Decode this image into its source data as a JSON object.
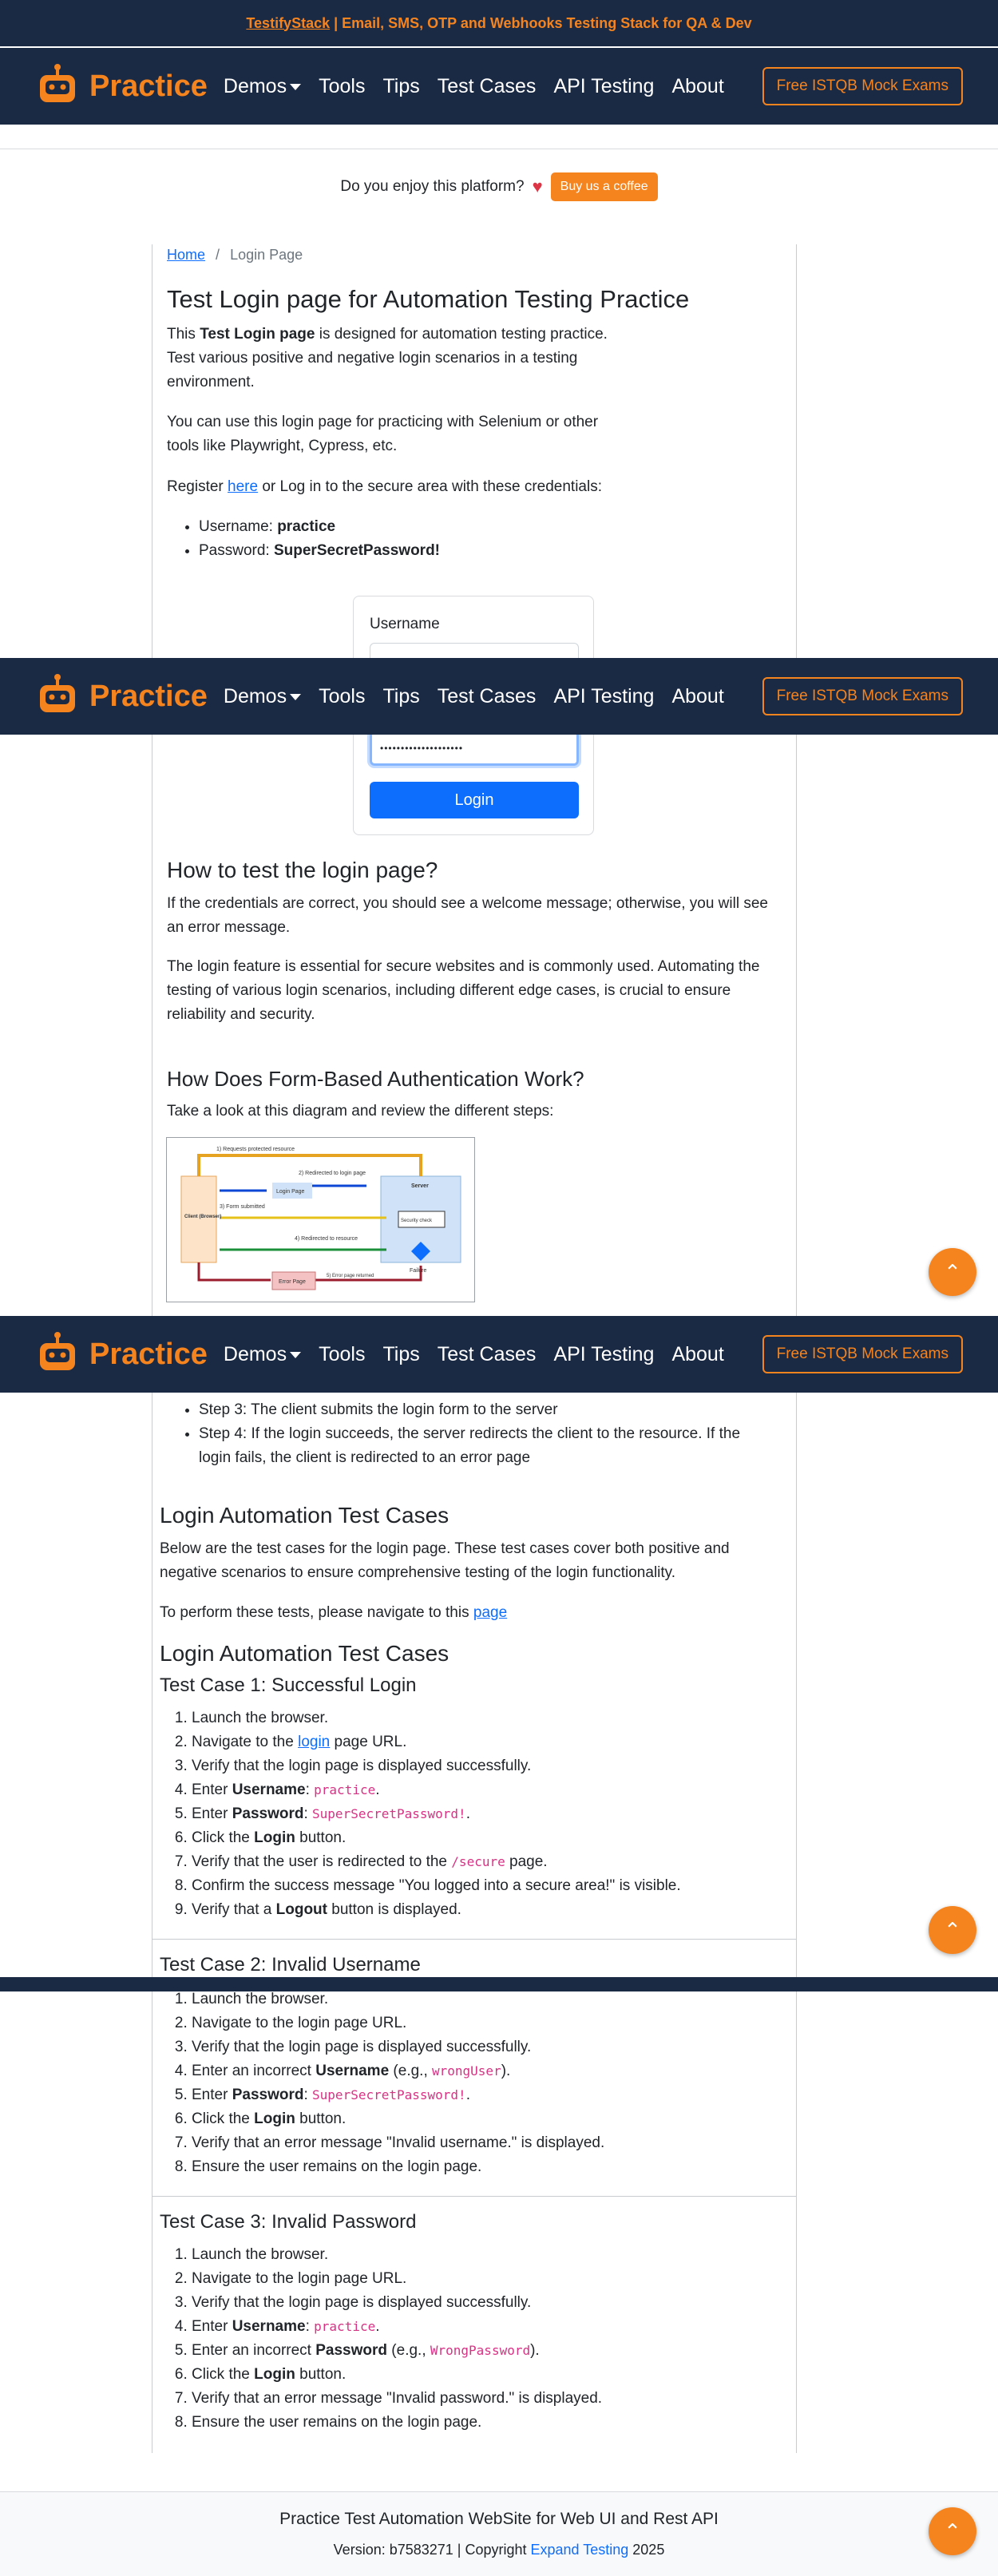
{
  "topbar": {
    "brand": "TestifyStack",
    "tagline": " | Email, SMS, OTP and Webhooks Testing Stack for QA & Dev"
  },
  "nav": {
    "logo_text": "Practice",
    "items": [
      "Demos",
      "Tools",
      "Tips",
      "Test Cases",
      "API Testing",
      "About"
    ],
    "exam_button": "Free ISTQB Mock Exams"
  },
  "coffee": {
    "text": "Do you enjoy this platform?",
    "button": "Buy us a coffee"
  },
  "breadcrumb": {
    "home": "Home",
    "sep": "/",
    "current": "Login Page"
  },
  "intro": {
    "title": "Test Login page for Automation Testing Practice",
    "p1_a": "This ",
    "p1_b": "Test Login page",
    "p1_c": " is designed for automation testing practice. Test various positive and negative login scenarios in a testing environment.",
    "p2": "You can use this login page for practicing with Selenium or other tools like Playwright, Cypress, etc.",
    "p3_a": "Register ",
    "p3_link": "here",
    "p3_b": " or Log in to the secure area with these credentials:",
    "cred_user_label": "Username: ",
    "cred_user": "practice",
    "cred_pass_label": "Password: ",
    "cred_pass": "SuperSecretPassword!"
  },
  "login_form": {
    "username_label": "Username",
    "password_value": "••••••••••••••••••••",
    "button": "Login"
  },
  "how_to": {
    "title": "How to test the login page?",
    "p1": "If the credentials are correct, you should see a welcome message; otherwise, you will see an error message.",
    "p2": "The login feature is essential for secure websites and is commonly used. Automating the testing of various login scenarios, including different edge cases, is crucial to ensure reliability and security."
  },
  "form_auth": {
    "title": "How Does Form-Based Authentication Work?",
    "p1": "Take a look at this diagram and review the different steps:",
    "diagram": {
      "requests": "1) Requests protected resource",
      "redirected_login": "2) Redirected to login page",
      "login_page": "Login Page",
      "form_submitted": "3) Form submitted",
      "redirected_resource": "4) Redirected to resource",
      "client": "Client (Browser)",
      "server": "Server",
      "security_check": "Security check",
      "failure": "Failure",
      "error_returned": "5) Error page returned",
      "error_page": "Error Page"
    },
    "step3": "Step 3: The client submits the login form to the server",
    "step4": "Step 4: If the login succeeds, the server redirects the client to the resource. If the login fails, the client is redirected to an error page"
  },
  "automation": {
    "title": "Login Automation Test Cases",
    "p1": "Below are the test cases for the login page. These test cases cover both positive and negative scenarios to ensure comprehensive testing of the login functionality.",
    "p2_a": "To perform these tests, please navigate to this ",
    "p2_link": "page",
    "title2": "Login Automation Test Cases"
  },
  "tc1": {
    "title": "Test Case 1: Successful Login",
    "s1": "Launch the browser.",
    "s2_a": "Navigate to the ",
    "s2_link": "login",
    "s2_b": " page URL.",
    "s3": "Verify that the login page is displayed successfully.",
    "s4_a": "Enter ",
    "s4_b": "Username",
    "s4_c": ": ",
    "s4_code": "practice",
    "s4_d": ".",
    "s5_a": "Enter ",
    "s5_b": "Password",
    "s5_c": ": ",
    "s5_code": "SuperSecretPassword!",
    "s5_d": ".",
    "s6_a": "Click the ",
    "s6_b": "Login",
    "s6_c": " button.",
    "s7_a": "Verify that the user is redirected to the ",
    "s7_code": "/secure",
    "s7_b": " page.",
    "s8": "Confirm the success message \"You logged into a secure area!\" is visible.",
    "s9_a": "Verify that a ",
    "s9_b": "Logout",
    "s9_c": " button is displayed."
  },
  "tc2": {
    "title": "Test Case 2: Invalid Username",
    "s1": "Launch the browser.",
    "s2": "Navigate to the login page URL.",
    "s3": "Verify that the login page is displayed successfully.",
    "s4_a": "Enter an incorrect ",
    "s4_b": "Username",
    "s4_c": " (e.g., ",
    "s4_code": "wrongUser",
    "s4_d": ").",
    "s5_a": "Enter ",
    "s5_b": "Password",
    "s5_c": ": ",
    "s5_code": "SuperSecretPassword!",
    "s5_d": ".",
    "s6_a": "Click the ",
    "s6_b": "Login",
    "s6_c": " button.",
    "s7": "Verify that an error message \"Invalid username.\" is displayed.",
    "s8": "Ensure the user remains on the login page."
  },
  "tc3": {
    "title": "Test Case 3: Invalid Password",
    "s1": "Launch the browser.",
    "s2": "Navigate to the login page URL.",
    "s3": "Verify that the login page is displayed successfully.",
    "s4_a": "Enter ",
    "s4_b": "Username",
    "s4_c": ": ",
    "s4_code": "practice",
    "s4_d": ".",
    "s5_a": "Enter an incorrect ",
    "s5_b": "Password",
    "s5_c": " (e.g., ",
    "s5_code": "WrongPassword",
    "s5_d": ").",
    "s6_a": "Click the ",
    "s6_b": "Login",
    "s6_c": " button.",
    "s7": "Verify that an error message \"Invalid password.\" is displayed.",
    "s8": "Ensure the user remains on the login page."
  },
  "footer": {
    "title": "Practice Test Automation WebSite for Web UI and Rest API",
    "version_a": "Version: b7583271 | Copyright ",
    "version_link": "Expand Testing",
    "version_b": " 2025"
  },
  "colors": {
    "navy": "#1b2a44",
    "orange": "#f5841f",
    "link": "#0d6efd"
  }
}
